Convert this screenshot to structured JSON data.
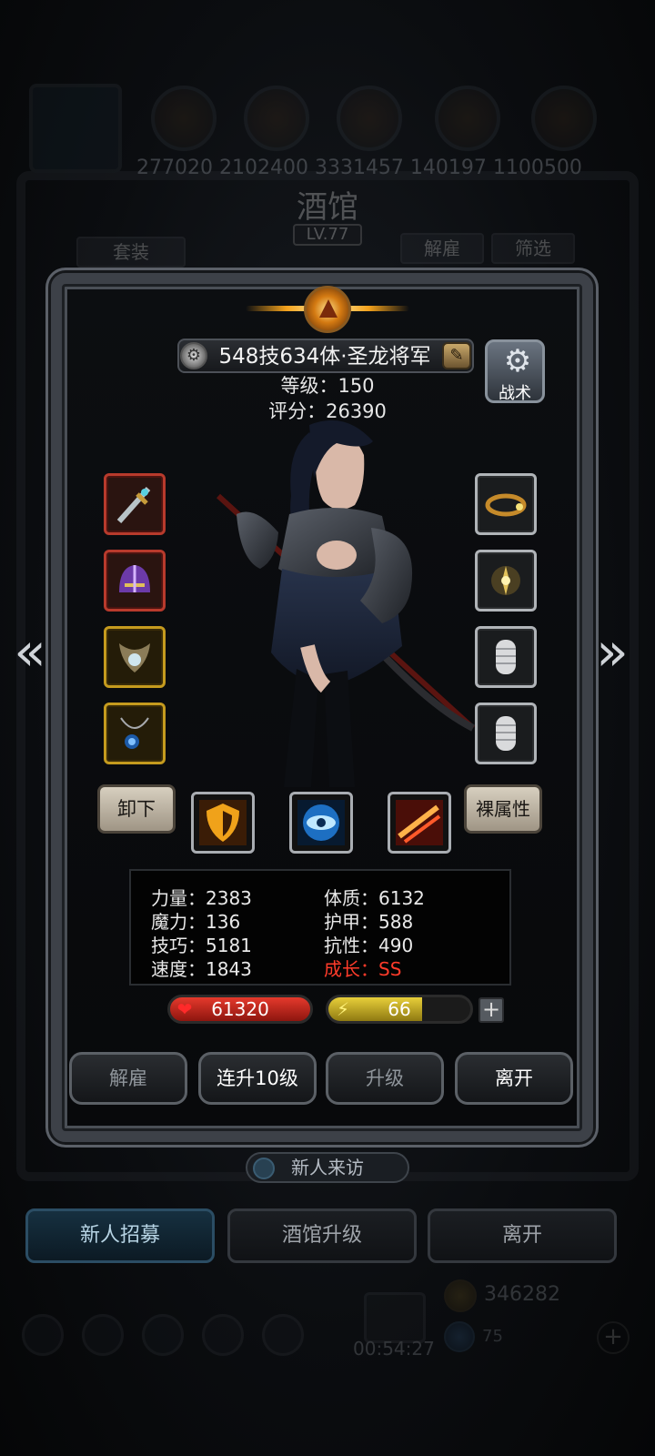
{
  "background": {
    "resource_numbers": "277020 2102400 3331457 140197 1100500",
    "title": "酒馆",
    "level": "LV.77",
    "left_button": "套装",
    "fire_button": "解雇",
    "filter_button": "筛选",
    "visitor_label": "新人来访",
    "bottom_tabs": [
      "新人招募",
      "酒馆升级",
      "离开"
    ],
    "gold": "346282",
    "gems": "75",
    "timer": "00:54:27"
  },
  "hero": {
    "name": "548技634体·圣龙将军",
    "level_label": "等级：150",
    "score_label": "评分：26390",
    "tactics_label": "战术"
  },
  "equipment": {
    "left": [
      "sword-icon",
      "helmet-icon",
      "amulet-icon",
      "necklace-icon"
    ],
    "right": [
      "ring-icon",
      "trinket-icon",
      "bracer-icon",
      "bracer-icon"
    ]
  },
  "skills": {
    "unequip_label": "卸下",
    "base_attr_label": "裸属性",
    "icons": [
      "shield-skill-icon",
      "eye-skill-icon",
      "slash-skill-icon"
    ]
  },
  "stats": {
    "strength": "力量：2383",
    "magic": "魔力：136",
    "skill": "技巧：5181",
    "speed": "速度：1843",
    "constitution": "体质：6132",
    "armor": "护甲：588",
    "resistance": "抗性：490",
    "growth": "成长：SS"
  },
  "vitals": {
    "hp": "61320",
    "energy": "66",
    "energy_fraction": 0.66,
    "plus_label": "+"
  },
  "actions": [
    "解雇",
    "连升10级",
    "升级",
    "离开"
  ],
  "colors": {
    "growth_text": "#ff3b2a",
    "hp_bar": "#e5392c",
    "energy_bar": "#e8cf3a",
    "stone_button": "#d7cfbf"
  }
}
